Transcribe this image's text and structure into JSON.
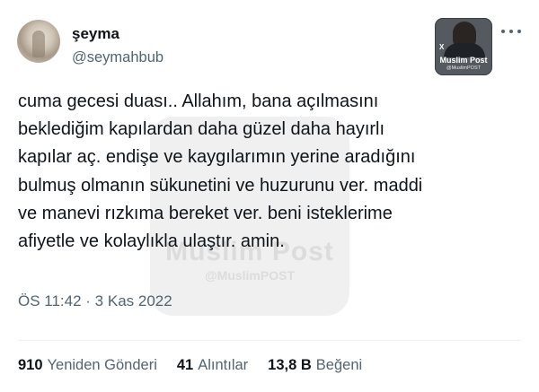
{
  "author": {
    "display_name": "şeyma",
    "handle": "@seymahbub"
  },
  "badge": {
    "name": "Muslim Post",
    "sub": "@MuslimPOST",
    "x_mark": "X"
  },
  "watermark": {
    "text": "Muslim Post",
    "sub": "@MuslimPOST"
  },
  "tweet": {
    "lines": [
      "cuma gecesi duası.. Allahım, bana açılmasını",
      "beklediğim kapılardan daha güzel daha hayırlı",
      "kapılar aç. endişe ve kaygılarımın yerine aradığını",
      "bulmuş olmanın sükunetini ve huzurunu ver. maddi",
      "ve manevi rızkıma bereket ver. beni isteklerime",
      "afiyetle ve kolaylıkla ulaştır. amin."
    ],
    "timestamp": "ÖS 11:42 · 3 Kas 2022"
  },
  "stats": [
    {
      "value": "910",
      "label": "Yeniden Gönderi"
    },
    {
      "value": "41",
      "label": "Alıntılar"
    },
    {
      "value": "13,8 B",
      "label": "Beğeni"
    }
  ],
  "icons": {
    "more": "more-horizontal-icon"
  }
}
